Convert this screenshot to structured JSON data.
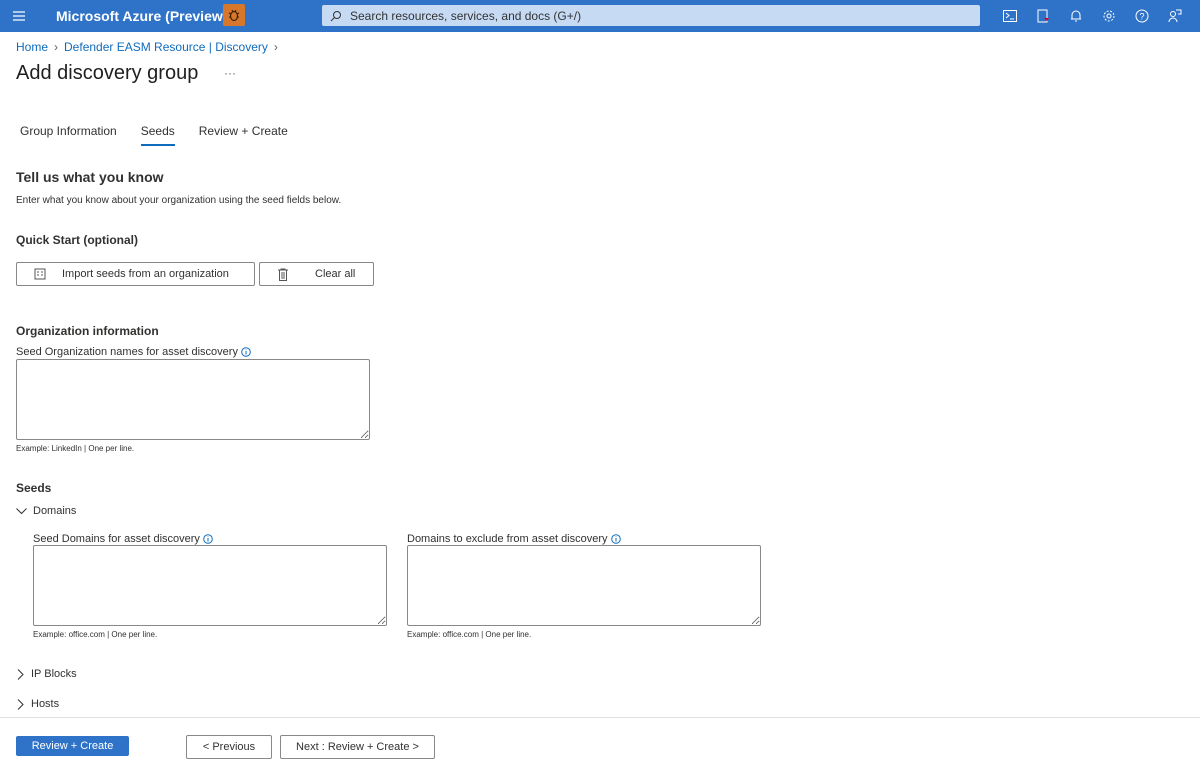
{
  "topbar": {
    "title": "Microsoft Azure (Preview)",
    "search_placeholder": "Search resources, services, and docs (G+/)",
    "icons": [
      "cloud-shell-icon",
      "directory-filter-icon",
      "bell-icon",
      "gear-icon",
      "help-icon",
      "feedback-icon"
    ],
    "color": "#2f73c9"
  },
  "breadcrumb": [
    "Home",
    "Defender EASM Resource | Discovery"
  ],
  "page": {
    "title": "Add discovery group",
    "more": "···"
  },
  "tabs": [
    {
      "label": "Group Information"
    },
    {
      "label": "Seeds",
      "active": true
    },
    {
      "label": "Review + Create"
    }
  ],
  "intro": {
    "heading": "Tell us what you know",
    "text": "Enter what you know about your organization using the seed fields below."
  },
  "quickstart": {
    "heading": "Quick Start (optional)",
    "import_label": "Import seeds from an organization",
    "clear_label": "Clear all"
  },
  "org": {
    "heading": "Organization information",
    "label": "Seed Organization names for asset discovery",
    "value": "",
    "hint": "Example: LinkedIn | One per line."
  },
  "seeds": {
    "heading": "Seeds",
    "domains": {
      "label": "Domains",
      "expanded": true,
      "seed_label": "Seed Domains for asset discovery",
      "seed_value": "",
      "seed_hint": "Example: office.com | One per line.",
      "exclude_label": "Domains to exclude from asset discovery",
      "exclude_value": "",
      "exclude_hint": "Example: office.com | One per line."
    },
    "ip_blocks": {
      "label": "IP Blocks",
      "expanded": false
    },
    "hosts": {
      "label": "Hosts",
      "expanded": false
    }
  },
  "footer": {
    "review_create": "Review + Create",
    "previous": "< Previous",
    "next": "Next : Review + Create >"
  }
}
